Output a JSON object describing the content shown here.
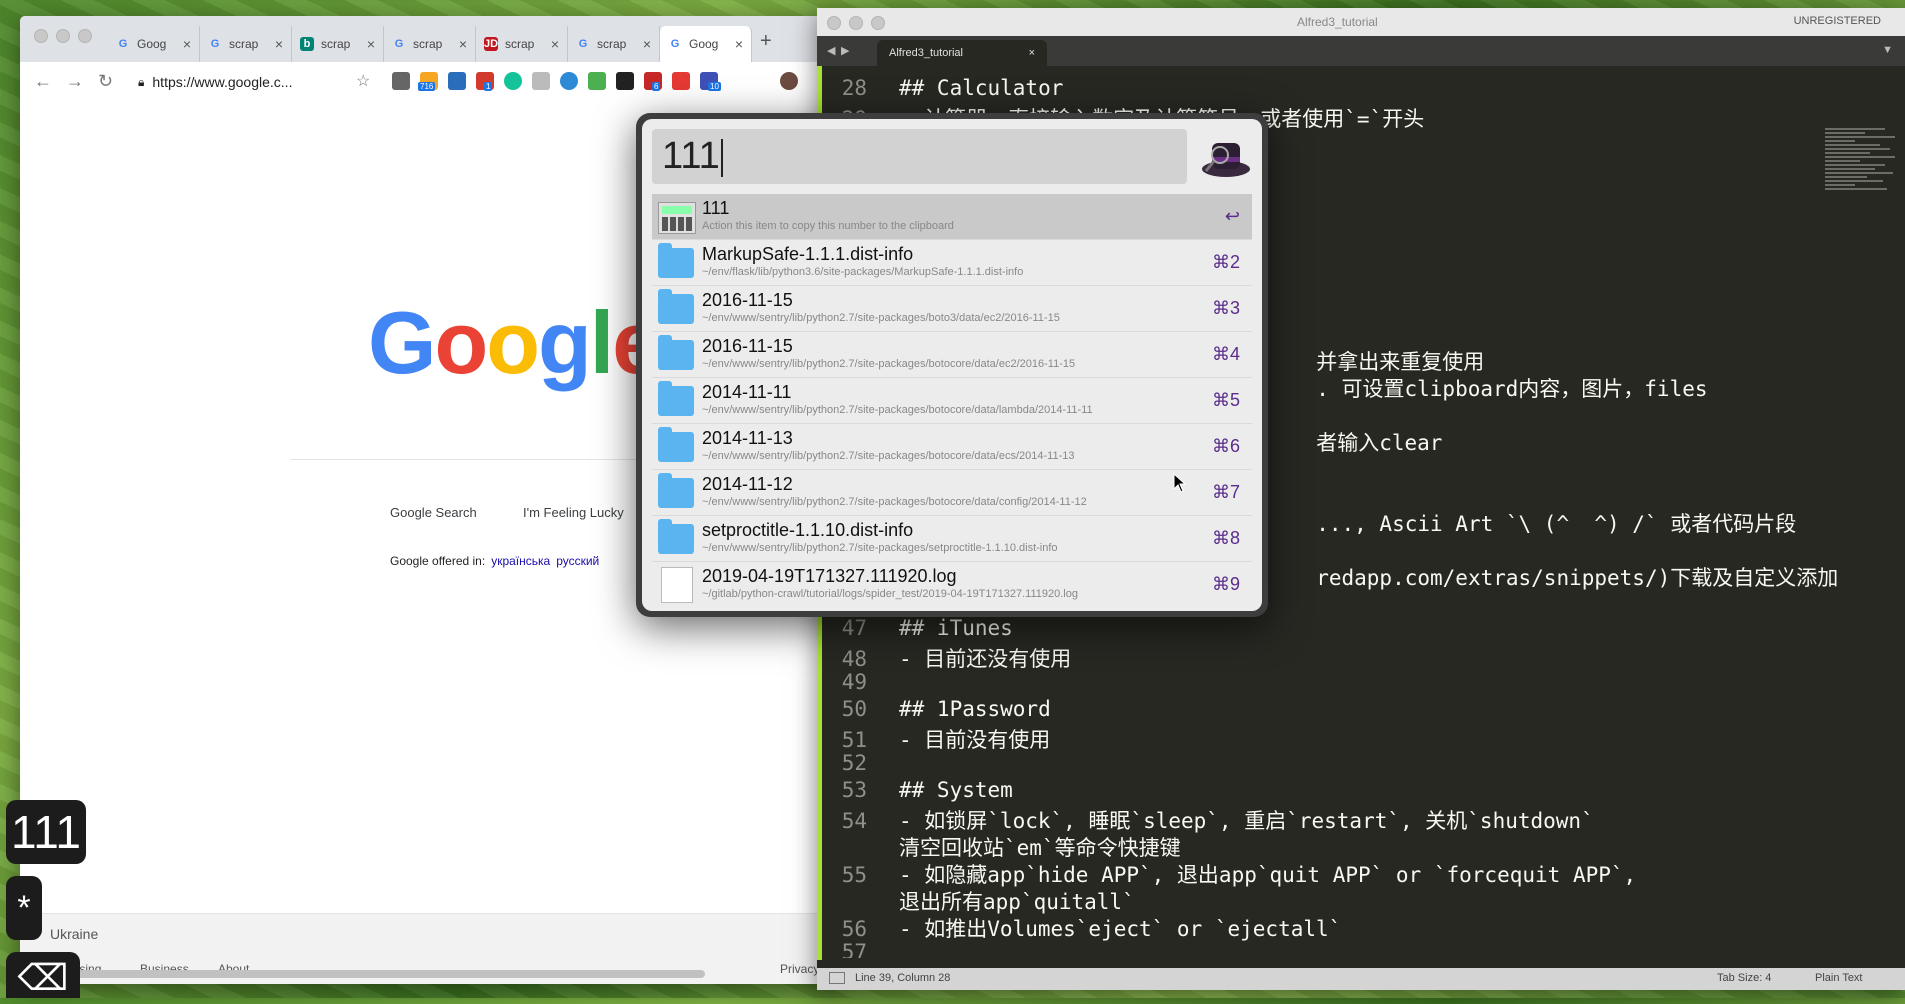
{
  "chrome": {
    "tabs": [
      {
        "icon": "google-icon",
        "label": "Goog"
      },
      {
        "icon": "google-icon",
        "label": "scrap"
      },
      {
        "icon": "bing-icon",
        "label": "scrap"
      },
      {
        "icon": "google-icon",
        "label": "scrap"
      },
      {
        "icon": "jd-icon",
        "label": "scrap"
      },
      {
        "icon": "google-icon",
        "label": "scrap"
      },
      {
        "icon": "google-icon",
        "label": "Goog"
      }
    ],
    "url": "https://www.google.c...",
    "ext_badges": {
      "b1": "716",
      "b2": "1",
      "b3": "6",
      "b4": "10"
    },
    "page": {
      "logo": "Google",
      "search_button": "Google Search",
      "lucky_button": "I'm Feeling Lucky",
      "offered_in": "Google offered in:",
      "lang1": "українська",
      "lang2": "русский",
      "country": "Ukraine",
      "footer_advertising": "Advertising",
      "footer_business": "Business",
      "footer_about": "About",
      "footer_privacy": "Privacy"
    }
  },
  "sublime": {
    "title": "Alfred3_tutorial",
    "unregistered": "UNREGISTERED",
    "tab": "Alfred3_tutorial",
    "status_left": "Line 39, Column 28",
    "status_tab": "Tab Size: 4",
    "status_syntax": "Plain Text",
    "lines": [
      {
        "n": "28",
        "t": "## Calculator"
      },
      {
        "n": "29",
        "t": "- 计算器，直接输入数字及计算符号，或者使用`=`开头"
      },
      {
        "n": "",
        "t": "                                 并拿出来重复使用"
      },
      {
        "n": "",
        "t": "                                 . 可设置clipboard内容，图片，files"
      },
      {
        "n": "",
        "t": "                                 者输入clear"
      },
      {
        "n": "",
        "t": "                                 ..., Ascii Art `\\ (^  ^) /` 或者代码片段"
      },
      {
        "n": "",
        "t": "                                 redapp.com/extras/snippets/)下载及自定义添加"
      },
      {
        "n": "47",
        "t": "## iTunes"
      },
      {
        "n": "48",
        "t": "- 目前还没有使用"
      },
      {
        "n": "49",
        "t": ""
      },
      {
        "n": "50",
        "t": "## 1Password"
      },
      {
        "n": "51",
        "t": "- 目前没有使用"
      },
      {
        "n": "52",
        "t": ""
      },
      {
        "n": "53",
        "t": "## System"
      },
      {
        "n": "54",
        "t": "- 如锁屏`lock`, 睡眠`sleep`, 重启`restart`, 关机`shutdown`"
      },
      {
        "n": "",
        "t": "清空回收站`em`等命令快捷键"
      },
      {
        "n": "55",
        "t": "- 如隐藏app`hide APP`, 退出app`quit APP` or `forcequit APP`,"
      },
      {
        "n": "",
        "t": "退出所有app`quitall`"
      },
      {
        "n": "56",
        "t": "- 如推出Volumes`eject` or `ejectall`"
      },
      {
        "n": "57",
        "t": ""
      }
    ]
  },
  "alfred": {
    "query": "111",
    "results": [
      {
        "icon": "calculator-icon",
        "title": "111",
        "subtitle": "Action this item to copy this number to the clipboard",
        "shortcut": "↩"
      },
      {
        "icon": "folder-icon",
        "title": "MarkupSafe-1.1.1.dist-info",
        "subtitle": "~/env/flask/lib/python3.6/site-packages/MarkupSafe-1.1.1.dist-info",
        "shortcut": "⌘2"
      },
      {
        "icon": "folder-icon",
        "title": "2016-11-15",
        "subtitle": "~/env/www/sentry/lib/python2.7/site-packages/boto3/data/ec2/2016-11-15",
        "shortcut": "⌘3"
      },
      {
        "icon": "folder-icon",
        "title": "2016-11-15",
        "subtitle": "~/env/www/sentry/lib/python2.7/site-packages/botocore/data/ec2/2016-11-15",
        "shortcut": "⌘4"
      },
      {
        "icon": "folder-icon",
        "title": "2014-11-11",
        "subtitle": "~/env/www/sentry/lib/python2.7/site-packages/botocore/data/lambda/2014-11-11",
        "shortcut": "⌘5"
      },
      {
        "icon": "folder-icon",
        "title": "2014-11-13",
        "subtitle": "~/env/www/sentry/lib/python2.7/site-packages/botocore/data/ecs/2014-11-13",
        "shortcut": "⌘6"
      },
      {
        "icon": "folder-icon",
        "title": "2014-11-12",
        "subtitle": "~/env/www/sentry/lib/python2.7/site-packages/botocore/data/config/2014-11-12",
        "shortcut": "⌘7"
      },
      {
        "icon": "folder-icon",
        "title": "setproctitle-1.1.10.dist-info",
        "subtitle": "~/env/www/sentry/lib/python2.7/site-packages/setproctitle-1.1.10.dist-info",
        "shortcut": "⌘8"
      },
      {
        "icon": "file-icon",
        "title": "2019-04-19T171327.111920.log",
        "subtitle": "~/gitlab/python-crawl/tutorial/logs/spider_test/2019-04-19T171327.111920.log",
        "shortcut": "⌘9"
      }
    ]
  },
  "keystrokes": {
    "typed": "111",
    "asterisk": "*",
    "delete": "⌫"
  }
}
